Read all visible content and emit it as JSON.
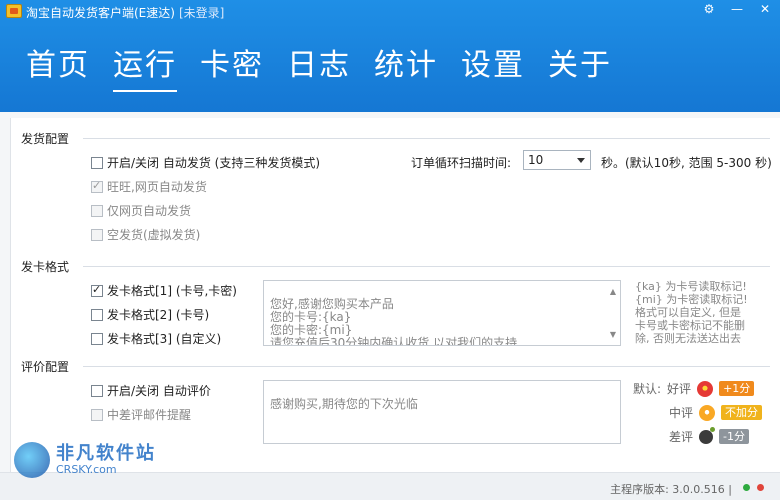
{
  "window": {
    "title": "淘宝自动发货客户端(E速达)",
    "status": "[未登录]"
  },
  "nav": {
    "tabs": [
      "首页",
      "运行",
      "卡密",
      "日志",
      "统计",
      "设置",
      "关于"
    ],
    "active": "运行"
  },
  "shipping": {
    "title": "发货配置",
    "toggle_label": "开启/关闭 自动发货 (支持三种发货模式)",
    "mode1": "旺旺,网页自动发货",
    "mode2": "仅网页自动发货",
    "mode3": "空发货(虚拟发货)",
    "interval_label": "订单循环扫描时间:",
    "interval_value": "10",
    "interval_hint": "秒。(默认10秒, 范围 5-300 秒)"
  },
  "card_format": {
    "title": "发卡格式",
    "format1": "发卡格式[1] (卡号,卡密)",
    "format2": "发卡格式[2] (卡号)",
    "format3": "发卡格式[3] (自定义)",
    "template_text": "您好,感谢您购买本产品\n您的卡号:{ka}\n您的卡密:{mi}\n请您充值后30分钟内确认收货,以对我们的支持",
    "note_line1": "{ka} 为卡号读取标记!",
    "note_line2": "{mi} 为卡密读取标记!",
    "note_line3": "格式可以自定义, 但是",
    "note_line4": "卡号或卡密标记不能删",
    "note_line5": "除, 否则无法送达出去"
  },
  "review": {
    "title": "评价配置",
    "toggle_label": "开启/关闭 自动评价",
    "bad_review_alert": "中差评邮件提醒",
    "review_text": "感谢购买,期待您的下次光临",
    "default_label": "默认:",
    "good_label": "好评",
    "good_badge": "+1分",
    "neutral_label": "中评",
    "neutral_badge": "不加分",
    "bad_label": "差评",
    "bad_badge": "-1分"
  },
  "footer": {
    "version": "主程序版本: 3.0.0.516 |",
    "watermark_cn": "非凡软件站",
    "watermark_en": "CRSKY.com"
  },
  "colors": {
    "header": "#1a84dc",
    "good_badge": "#f08a1c",
    "neutral_badge": "#f0b31c",
    "bad_badge": "#8e959c",
    "status_green": "#2eaa3f",
    "status_red": "#e0443a"
  }
}
